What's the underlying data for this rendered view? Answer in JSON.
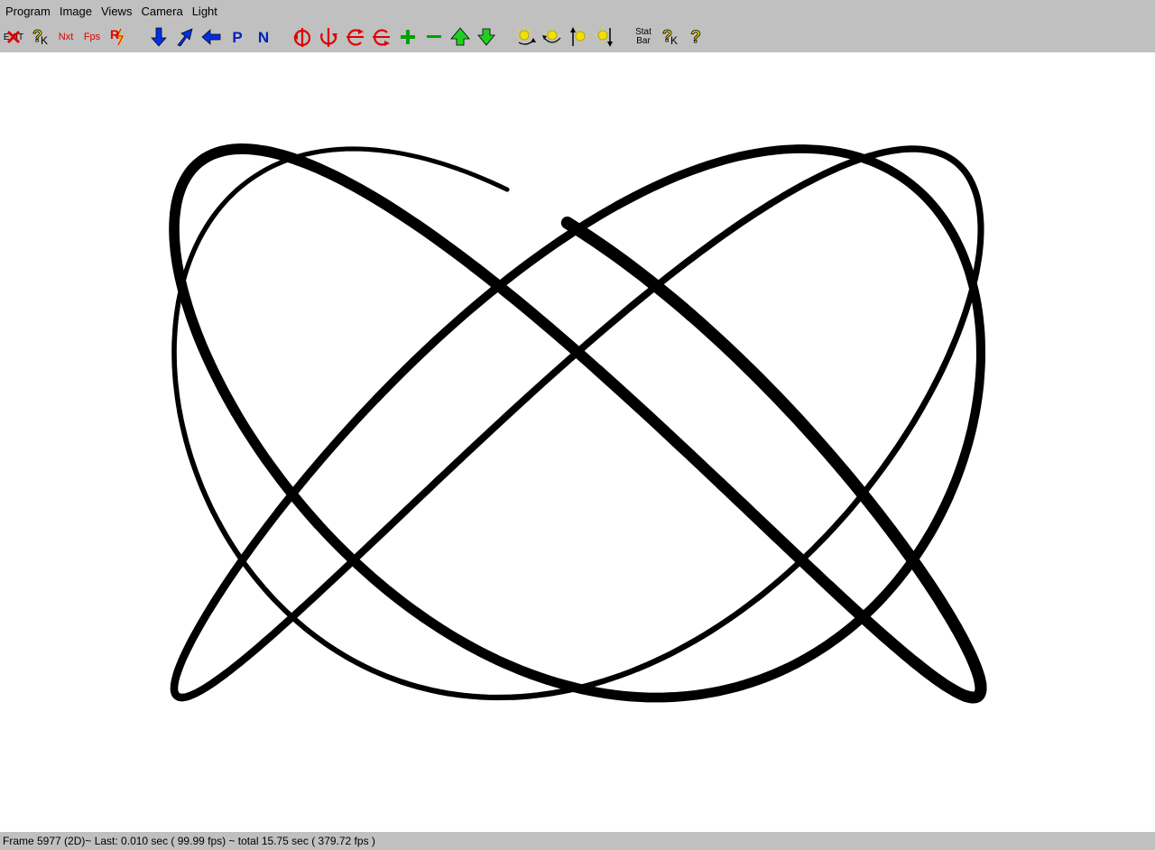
{
  "menu": {
    "items": [
      {
        "label": "Program"
      },
      {
        "label": "Image"
      },
      {
        "label": "Views"
      },
      {
        "label": "Camera"
      },
      {
        "label": "Light"
      }
    ]
  },
  "toolbar": {
    "exit_label": "EXIT",
    "help_k_label": "K",
    "next_label": "Nxt",
    "fps_label": "Fps",
    "reset_label": "R",
    "p_label": "P",
    "n_label": "N",
    "stat_bar_line1": "Stat",
    "stat_bar_line2": "Bar",
    "help2_k_label": "K",
    "help_label": "?",
    "icons": {
      "exit": "exit-icon",
      "key_help": "key-help-icon",
      "next": "next-icon",
      "fps": "fps-icon",
      "reset": "reset-icon",
      "down_arrow": "arrow-down-icon",
      "up_right_arrow": "arrow-up-right-icon",
      "left_arrow": "arrow-left-icon",
      "rotate_y_left": "rotate-y-left-icon",
      "rotate_y_right": "rotate-y-right-icon",
      "rotate_x_up": "rotate-x-up-icon",
      "rotate_x_down": "rotate-x-down-icon",
      "zoom_in": "plus-icon",
      "zoom_out": "minus-icon",
      "move_up": "triangle-up-icon",
      "move_down": "triangle-down-icon",
      "light_1": "light-rotate-left-icon",
      "light_2": "light-rotate-right-icon",
      "light_3": "light-up-icon",
      "light_4": "light-down-icon"
    }
  },
  "colors": {
    "chrome_bg": "#c0c0c0",
    "canvas_bg": "#ffffff",
    "curve": "#000000",
    "icon_red": "#e00000",
    "icon_blue": "#0000cc",
    "icon_green": "#00b000",
    "icon_yellow": "#f0e000"
  },
  "status": {
    "text": "Frame 5977 (2D)~ Last: 0.010 sec ( 99.99 fps) ~ total 15.75 sec ( 379.72 fps )"
  }
}
